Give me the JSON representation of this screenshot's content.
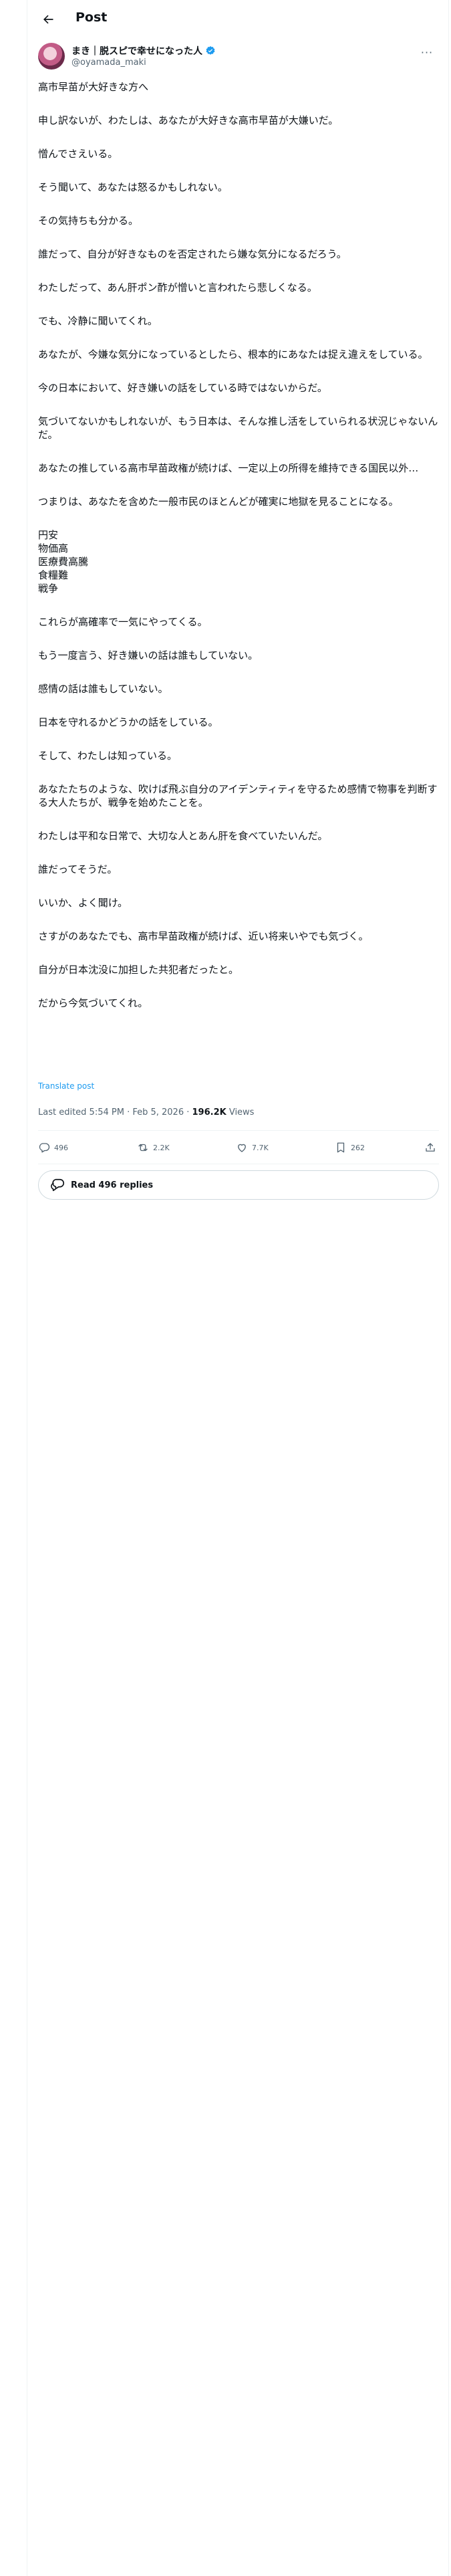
{
  "header": {
    "title": "Post"
  },
  "author": {
    "name": "まき｜脱スピで幸せになった人",
    "handle": "@oyamada_maki",
    "verified": true
  },
  "post": {
    "paragraphs": [
      "高市早苗が大好きな方へ",
      "申し訳ないが、わたしは、あなたが大好きな高市早苗が大嫌いだ。",
      "憎んでさえいる。",
      "そう聞いて、あなたは怒るかもしれない。",
      "その気持ちも分かる。",
      "誰だって、自分が好きなものを否定されたら嫌な気分になるだろう。",
      "わたしだって、あん肝ポン酢が憎いと言われたら悲しくなる。",
      "でも、冷静に聞いてくれ。",
      "あなたが、今嫌な気分になっているとしたら、根本的にあなたは捉え違えをしている。",
      "今の日本において、好き嫌いの話をしている時ではないからだ。",
      "気づいてないかもしれないが、もう日本は、そんな推し活をしていられる状況じゃないんだ。",
      "あなたの推している高市早苗政権が続けば、一定以上の所得を維持できる国民以外…",
      "つまりは、あなたを含めた一般市民のほとんどが確実に地獄を見ることになる。"
    ],
    "list": [
      "円安",
      "物価高",
      "医療費高騰",
      "食糧難",
      "戦争"
    ],
    "paragraphs2": [
      "これらが高確率で一気にやってくる。",
      "もう一度言う、好き嫌いの話は誰もしていない。",
      "感情の話は誰もしていない。",
      "日本を守れるかどうかの話をしている。",
      "そして、わたしは知っている。",
      "あなたたちのような、吹けば飛ぶ自分のアイデンティティを守るため感情で物事を判断する大人たちが、戦争を始めたことを。",
      "わたしは平和な日常で、大切な人とあん肝を食べていたいんだ。",
      "誰だってそうだ。",
      "いいか、よく聞け。",
      "さすがのあなたでも、高市早苗政権が続けば、近い将来いやでも気づく。",
      "自分が日本沈没に加担した共犯者だったと。",
      "だから今気づいてくれ。"
    ],
    "translate": "Translate post",
    "edited": "Last edited 5:54 PM · Feb 5, 2026 · ",
    "views_count": "196.2K",
    "views_label": " Views"
  },
  "actions": {
    "replies": "496",
    "reposts": "2.2K",
    "likes": "7.7K",
    "bookmarks": "262"
  },
  "read_replies": "Read 496 replies",
  "colors": {
    "accent": "#1d9bf0",
    "text": "#0f1419",
    "muted": "#536471",
    "border": "#eff3f4"
  }
}
